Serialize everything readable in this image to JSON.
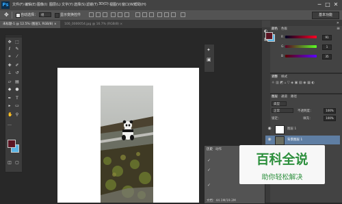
{
  "app": {
    "logo": "Ps",
    "menu": [
      "文件(F)",
      "编辑(E)",
      "图像(I)",
      "图层(L)",
      "文字(Y)",
      "选择(S)",
      "滤镜(T)",
      "3D(D)",
      "视图(V)",
      "窗口(W)",
      "帮助(H)"
    ],
    "window_controls": [
      "─",
      "□",
      "✕"
    ]
  },
  "options_bar": {
    "auto_select_label": "自动选择：",
    "auto_select_value": "组",
    "transform_controls_label": "显示变换控件",
    "workspace_button": "基本功能"
  },
  "document_tabs": [
    {
      "label": "未标题-1 @ 12.5% (图层1, RGB/8) ×",
      "active": true
    },
    {
      "label": "100_0000054.jpg @ 16.7% (RGB/8) ×",
      "active": false
    }
  ],
  "toolbox": {
    "tools": [
      "move-tool",
      "marquee-tool",
      "lasso-tool",
      "quick-select-tool",
      "crop-tool",
      "eyedropper-tool",
      "healing-tool",
      "brush-tool",
      "clone-tool",
      "history-brush-tool",
      "eraser-tool",
      "gradient-tool",
      "blur-tool",
      "dodge-tool",
      "pen-tool",
      "type-tool",
      "path-select-tool",
      "shape-tool",
      "hand-tool",
      "zoom-tool"
    ],
    "foreground_color": "#5c1523",
    "background_color": "#5ab4e5"
  },
  "color_panel": {
    "tabs": [
      "颜色",
      "色板"
    ],
    "channels": [
      {
        "label": "R",
        "value": "91"
      },
      {
        "label": "G",
        "value": "1"
      },
      {
        "label": "B",
        "value": "35"
      }
    ]
  },
  "adjust_panel": {
    "tabs": [
      "调整",
      "样式"
    ]
  },
  "layers_panel": {
    "tabs": [
      "图层",
      "通道",
      "路径"
    ],
    "kind_label": "类型",
    "blend_mode": "正常",
    "opacity_label": "不透明度：",
    "opacity_value": "100%",
    "lock_label": "锁定：",
    "fill_label": "填充：",
    "fill_value": "100%",
    "layers": [
      {
        "name": "图层 1",
        "selected": false
      },
      {
        "name": "背景图层 1",
        "selected": true
      }
    ]
  },
  "history_panel": {
    "tabs": [
      "历史",
      "动作"
    ],
    "footer": "文档：44.1M/19.2M"
  },
  "watermark": {
    "title": "百科全说",
    "subtitle": "助你轻松解决"
  },
  "colors": {
    "ps_blue": "#31a8ff",
    "selected_layer": "#5f7ea3",
    "watermark_green": "#2c8f3c"
  }
}
